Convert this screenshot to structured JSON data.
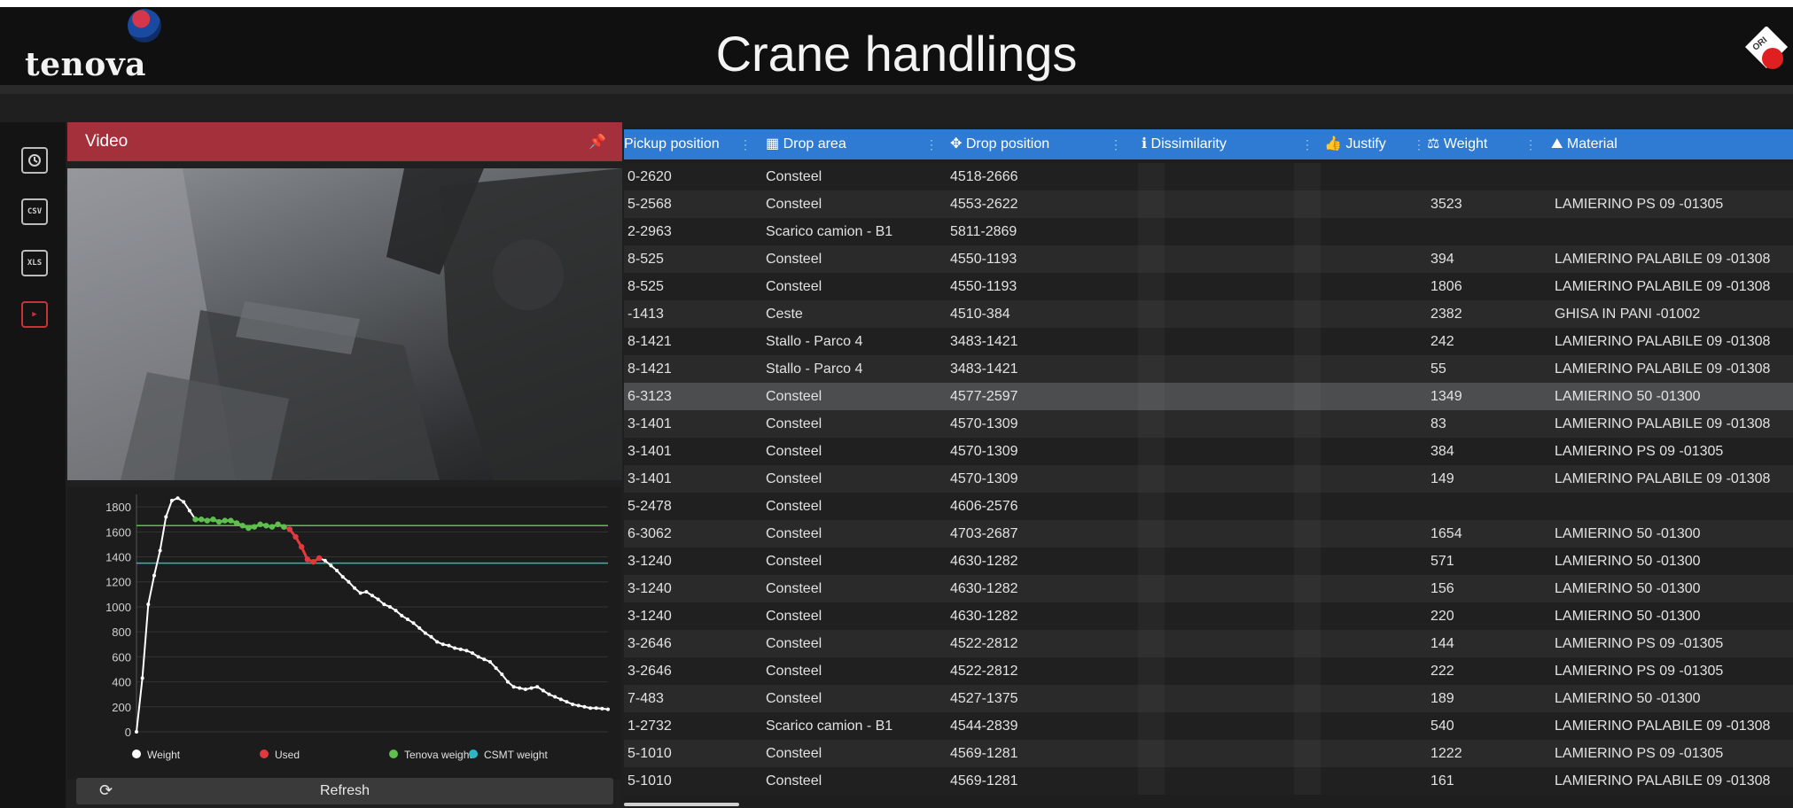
{
  "header": {
    "brand": "tenova",
    "title": "Crane handlings",
    "corner_logo_text": "ORI"
  },
  "sidebar": {
    "items": [
      {
        "icon": "history-icon",
        "label": ""
      },
      {
        "icon": "csv-export-icon",
        "label": "CSV"
      },
      {
        "icon": "xls-export-icon",
        "label": "XLS"
      },
      {
        "icon": "play-icon",
        "label": "▶"
      }
    ]
  },
  "video_panel": {
    "title": "Video",
    "refresh_label": "Refresh"
  },
  "chart_data": {
    "type": "line",
    "title": "",
    "xlabel": "",
    "ylabel": "",
    "ylim": [
      0,
      1900
    ],
    "yticks": [
      0,
      200,
      400,
      600,
      800,
      1000,
      1200,
      1400,
      1600,
      1800
    ],
    "grid": true,
    "legend_position": "bottom",
    "legend": [
      {
        "name": "Weight",
        "color": "#ffffff"
      },
      {
        "name": "Used",
        "color": "#e0393e"
      },
      {
        "name": "Tenova weight",
        "color": "#5fbf4e"
      },
      {
        "name": "CSMT weight",
        "color": "#29b6c6"
      }
    ],
    "reference_lines": [
      {
        "name": "Tenova weight",
        "value": 1650,
        "color": "#5fbf4e"
      },
      {
        "name": "CSMT weight",
        "value": 1350,
        "color": "#29b6c6"
      }
    ],
    "series": [
      {
        "name": "Weight",
        "color": "#ffffff",
        "x": [
          0,
          1,
          2,
          3,
          4,
          5,
          6,
          7,
          8,
          9,
          10,
          11,
          12,
          13,
          14,
          15,
          16,
          17,
          18,
          19,
          20,
          21,
          22,
          23,
          24,
          25,
          26,
          27,
          28,
          29,
          30,
          31,
          32,
          33,
          34,
          35,
          36,
          37,
          38,
          39,
          40,
          41,
          42,
          43,
          44,
          45,
          46,
          47,
          48,
          49,
          50,
          51,
          52,
          53,
          54,
          55,
          56,
          57,
          58,
          59,
          60,
          61,
          62,
          63,
          64,
          65,
          66,
          67,
          68,
          69,
          70,
          71,
          72,
          73,
          74,
          75,
          76,
          77,
          78,
          79,
          80
        ],
        "values": [
          0,
          430,
          1020,
          1250,
          1450,
          1720,
          1850,
          1870,
          1840,
          1770,
          1700,
          1700,
          1690,
          1700,
          1680,
          1690,
          1690,
          1670,
          1650,
          1630,
          1640,
          1660,
          1650,
          1640,
          1660,
          1640,
          1620,
          1560,
          1480,
          1380,
          1360,
          1390,
          1370,
          1330,
          1290,
          1240,
          1200,
          1150,
          1110,
          1120,
          1090,
          1060,
          1020,
          1000,
          970,
          930,
          900,
          870,
          830,
          790,
          760,
          720,
          700,
          690,
          670,
          660,
          650,
          630,
          600,
          580,
          560,
          510,
          460,
          400,
          360,
          350,
          340,
          350,
          360,
          330,
          300,
          280,
          260,
          240,
          220,
          210,
          200,
          190,
          190,
          185,
          180
        ]
      },
      {
        "name": "Used",
        "color": "#e0393e",
        "x": [
          24,
          25,
          26,
          27,
          28,
          29,
          30,
          31
        ],
        "values": [
          1660,
          1640,
          1620,
          1560,
          1480,
          1380,
          1360,
          1390
        ]
      },
      {
        "name": "Tenova weight",
        "color": "#5fbf4e",
        "x": [
          10,
          11,
          12,
          13,
          14,
          15,
          16,
          17,
          18,
          19,
          20,
          21,
          22,
          23,
          24,
          25
        ],
        "values": [
          1700,
          1700,
          1690,
          1700,
          1680,
          1690,
          1690,
          1670,
          1650,
          1630,
          1640,
          1660,
          1650,
          1640,
          1660,
          1640
        ]
      }
    ]
  },
  "table": {
    "columns": [
      {
        "icon": "",
        "label": "Pickup position"
      },
      {
        "icon": "▦",
        "label": "Drop area"
      },
      {
        "icon": "✥",
        "label": "Drop position"
      },
      {
        "icon": "ℹ",
        "label": "Dissimilarity"
      },
      {
        "icon": "👍",
        "label": "Justify"
      },
      {
        "icon": "⚖",
        "label": "Weight"
      },
      {
        "icon": "⛰",
        "label": "Material"
      }
    ],
    "selected_row_index": 8,
    "rows": [
      {
        "pickup": "0-2620",
        "drop_area": "Consteel",
        "drop_position": "4518-2666",
        "dissimilarity": "",
        "justify": "",
        "weight": "",
        "material": ""
      },
      {
        "pickup": "5-2568",
        "drop_area": "Consteel",
        "drop_position": "4553-2622",
        "dissimilarity": "",
        "justify": "",
        "weight": "3523",
        "material": "LAMIERINO PS 09 -01305"
      },
      {
        "pickup": "2-2963",
        "drop_area": "Scarico camion - B1",
        "drop_position": "5811-2869",
        "dissimilarity": "",
        "justify": "",
        "weight": "",
        "material": ""
      },
      {
        "pickup": "8-525",
        "drop_area": "Consteel",
        "drop_position": "4550-1193",
        "dissimilarity": "",
        "justify": "",
        "weight": "394",
        "material": "LAMIERINO PALABILE 09 -01308"
      },
      {
        "pickup": "8-525",
        "drop_area": "Consteel",
        "drop_position": "4550-1193",
        "dissimilarity": "",
        "justify": "",
        "weight": "1806",
        "material": "LAMIERINO PALABILE 09 -01308"
      },
      {
        "pickup": "-1413",
        "drop_area": "Ceste",
        "drop_position": "4510-384",
        "dissimilarity": "",
        "justify": "",
        "weight": "2382",
        "material": "GHISA IN PANI -01002"
      },
      {
        "pickup": "8-1421",
        "drop_area": "Stallo - Parco 4",
        "drop_position": "3483-1421",
        "dissimilarity": "",
        "justify": "",
        "weight": "242",
        "material": "LAMIERINO PALABILE 09 -01308"
      },
      {
        "pickup": "8-1421",
        "drop_area": "Stallo - Parco 4",
        "drop_position": "3483-1421",
        "dissimilarity": "",
        "justify": "",
        "weight": "55",
        "material": "LAMIERINO PALABILE 09 -01308"
      },
      {
        "pickup": "6-3123",
        "drop_area": "Consteel",
        "drop_position": "4577-2597",
        "dissimilarity": "",
        "justify": "",
        "weight": "1349",
        "material": "LAMIERINO 50 -01300"
      },
      {
        "pickup": "3-1401",
        "drop_area": "Consteel",
        "drop_position": "4570-1309",
        "dissimilarity": "",
        "justify": "",
        "weight": "83",
        "material": "LAMIERINO PALABILE 09 -01308"
      },
      {
        "pickup": "3-1401",
        "drop_area": "Consteel",
        "drop_position": "4570-1309",
        "dissimilarity": "",
        "justify": "",
        "weight": "384",
        "material": "LAMIERINO PS 09 -01305"
      },
      {
        "pickup": "3-1401",
        "drop_area": "Consteel",
        "drop_position": "4570-1309",
        "dissimilarity": "",
        "justify": "",
        "weight": "149",
        "material": "LAMIERINO PALABILE 09 -01308"
      },
      {
        "pickup": "5-2478",
        "drop_area": "Consteel",
        "drop_position": "4606-2576",
        "dissimilarity": "",
        "justify": "",
        "weight": "",
        "material": ""
      },
      {
        "pickup": "6-3062",
        "drop_area": "Consteel",
        "drop_position": "4703-2687",
        "dissimilarity": "",
        "justify": "",
        "weight": "1654",
        "material": "LAMIERINO 50 -01300"
      },
      {
        "pickup": "3-1240",
        "drop_area": "Consteel",
        "drop_position": "4630-1282",
        "dissimilarity": "",
        "justify": "",
        "weight": "571",
        "material": "LAMIERINO 50 -01300"
      },
      {
        "pickup": "3-1240",
        "drop_area": "Consteel",
        "drop_position": "4630-1282",
        "dissimilarity": "",
        "justify": "",
        "weight": "156",
        "material": "LAMIERINO 50 -01300"
      },
      {
        "pickup": "3-1240",
        "drop_area": "Consteel",
        "drop_position": "4630-1282",
        "dissimilarity": "",
        "justify": "",
        "weight": "220",
        "material": "LAMIERINO 50 -01300"
      },
      {
        "pickup": "3-2646",
        "drop_area": "Consteel",
        "drop_position": "4522-2812",
        "dissimilarity": "",
        "justify": "",
        "weight": "144",
        "material": "LAMIERINO PS 09 -01305"
      },
      {
        "pickup": "3-2646",
        "drop_area": "Consteel",
        "drop_position": "4522-2812",
        "dissimilarity": "",
        "justify": "",
        "weight": "222",
        "material": "LAMIERINO PS 09 -01305"
      },
      {
        "pickup": "7-483",
        "drop_area": "Consteel",
        "drop_position": "4527-1375",
        "dissimilarity": "",
        "justify": "",
        "weight": "189",
        "material": "LAMIERINO 50 -01300"
      },
      {
        "pickup": "1-2732",
        "drop_area": "Scarico camion - B1",
        "drop_position": "4544-2839",
        "dissimilarity": "",
        "justify": "",
        "weight": "540",
        "material": "LAMIERINO PALABILE 09 -01308"
      },
      {
        "pickup": "5-1010",
        "drop_area": "Consteel",
        "drop_position": "4569-1281",
        "dissimilarity": "",
        "justify": "",
        "weight": "1222",
        "material": "LAMIERINO PS 09 -01305"
      },
      {
        "pickup": "5-1010",
        "drop_area": "Consteel",
        "drop_position": "4569-1281",
        "dissimilarity": "",
        "justify": "",
        "weight": "161",
        "material": "LAMIERINO PALABILE 09 -01308"
      }
    ]
  },
  "colors": {
    "header_bg": "#101010",
    "video_header": "#a3303a",
    "table_header": "#2f7bd3",
    "selected_row": "#4b4d4f"
  }
}
